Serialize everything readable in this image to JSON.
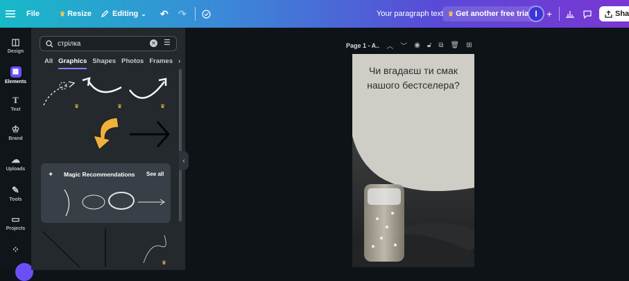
{
  "topbar": {
    "file_label": "File",
    "resize_label": "Resize",
    "editing_label": "Editing",
    "doc_title": "Your paragraph text",
    "trial_label": "Get another free trial",
    "avatar_initial": "I",
    "share_label": "Shar"
  },
  "rail": {
    "items": [
      {
        "label": "Design",
        "icon": "design-icon"
      },
      {
        "label": "Elements",
        "icon": "elements-icon"
      },
      {
        "label": "Text",
        "icon": "text-icon"
      },
      {
        "label": "Brand",
        "icon": "brand-icon"
      },
      {
        "label": "Uploads",
        "icon": "uploads-icon"
      },
      {
        "label": "Tools",
        "icon": "tools-icon"
      },
      {
        "label": "Projects",
        "icon": "projects-icon"
      }
    ]
  },
  "panel": {
    "search_value": "стрілка",
    "tabs": [
      "All",
      "Graphics",
      "Shapes",
      "Photos",
      "Frames"
    ],
    "active_tab": "Graphics",
    "magic_title": "Magic Recommendations",
    "see_all": "See all"
  },
  "canvas": {
    "page_label": "Page 1 - A..",
    "text_line1": "Чи вгадаєш ти смак",
    "text_line2": "нашого бестселера?",
    "bg_color": "#cfcdc6",
    "accent_color": "#6b4ff6"
  }
}
